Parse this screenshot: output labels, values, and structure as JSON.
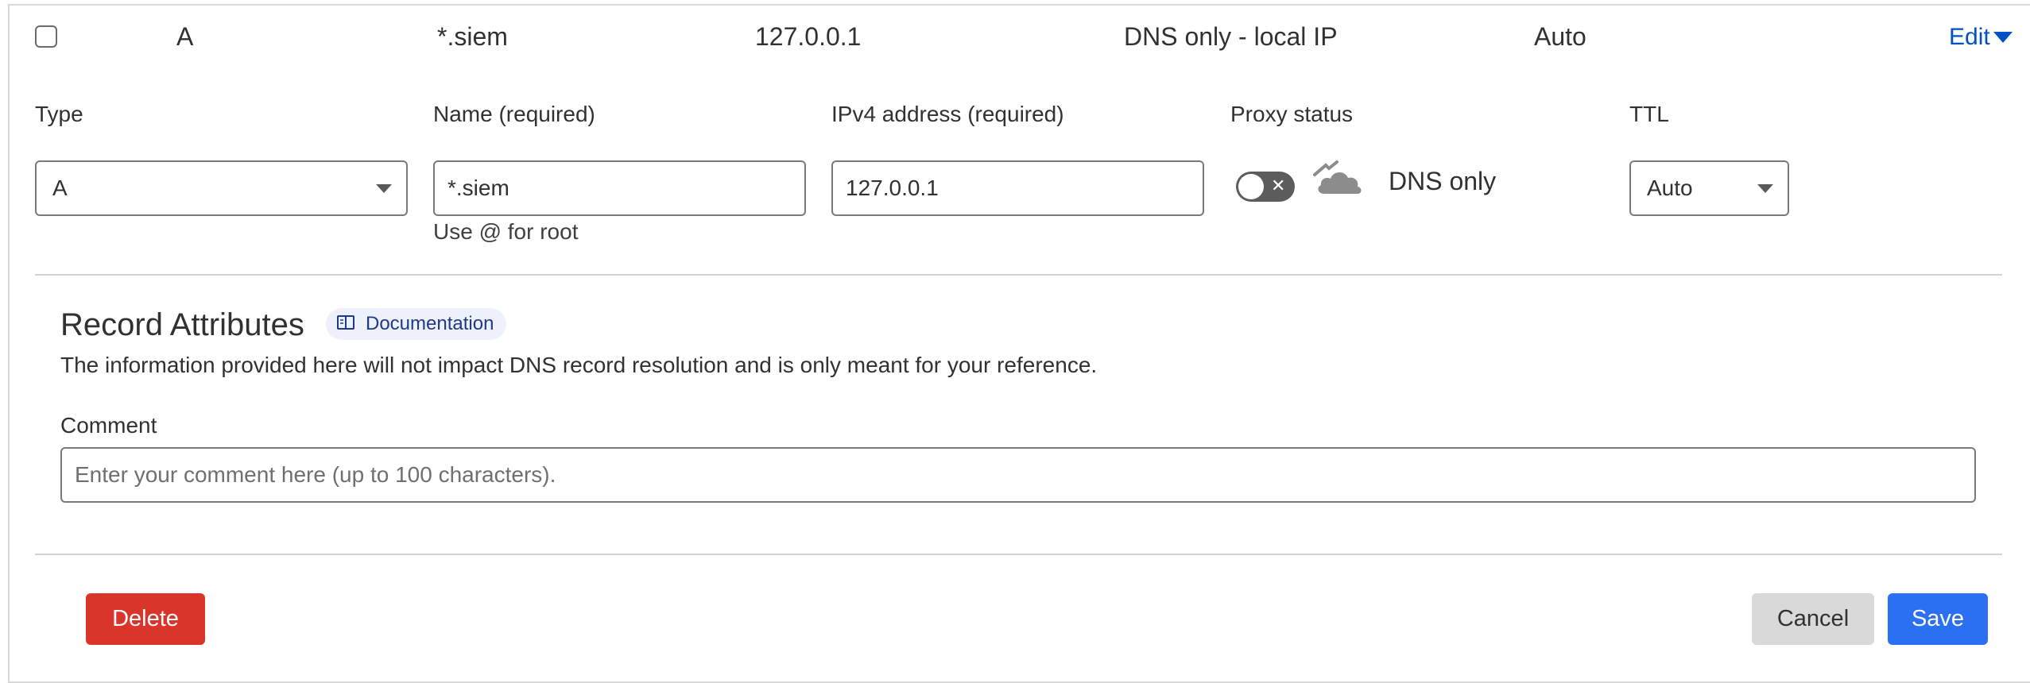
{
  "record_row": {
    "type": "A",
    "name": "*.siem",
    "content": "127.0.0.1",
    "proxy_status": "DNS only - local IP",
    "ttl": "Auto",
    "edit_label": "Edit"
  },
  "form": {
    "type": {
      "label": "Type",
      "value": "A"
    },
    "name": {
      "label": "Name (required)",
      "value": "*.siem",
      "hint": "Use @ for root"
    },
    "ipv4": {
      "label": "IPv4 address (required)",
      "value": "127.0.0.1"
    },
    "proxy": {
      "label": "Proxy status",
      "state_text": "DNS only",
      "enabled": false
    },
    "ttl": {
      "label": "TTL",
      "value": "Auto"
    }
  },
  "record_attributes": {
    "title": "Record Attributes",
    "doc_label": "Documentation",
    "description": "The information provided here will not impact DNS record resolution and is only meant for your reference.",
    "comment_label": "Comment",
    "comment_placeholder": "Enter your comment here (up to 100 characters).",
    "comment_value": ""
  },
  "actions": {
    "delete_label": "Delete",
    "cancel_label": "Cancel",
    "save_label": "Save"
  },
  "colors": {
    "link": "#0051c3",
    "danger": "#d9352b",
    "primary": "#2b6ff2",
    "secondary": "#d9d9d9"
  }
}
